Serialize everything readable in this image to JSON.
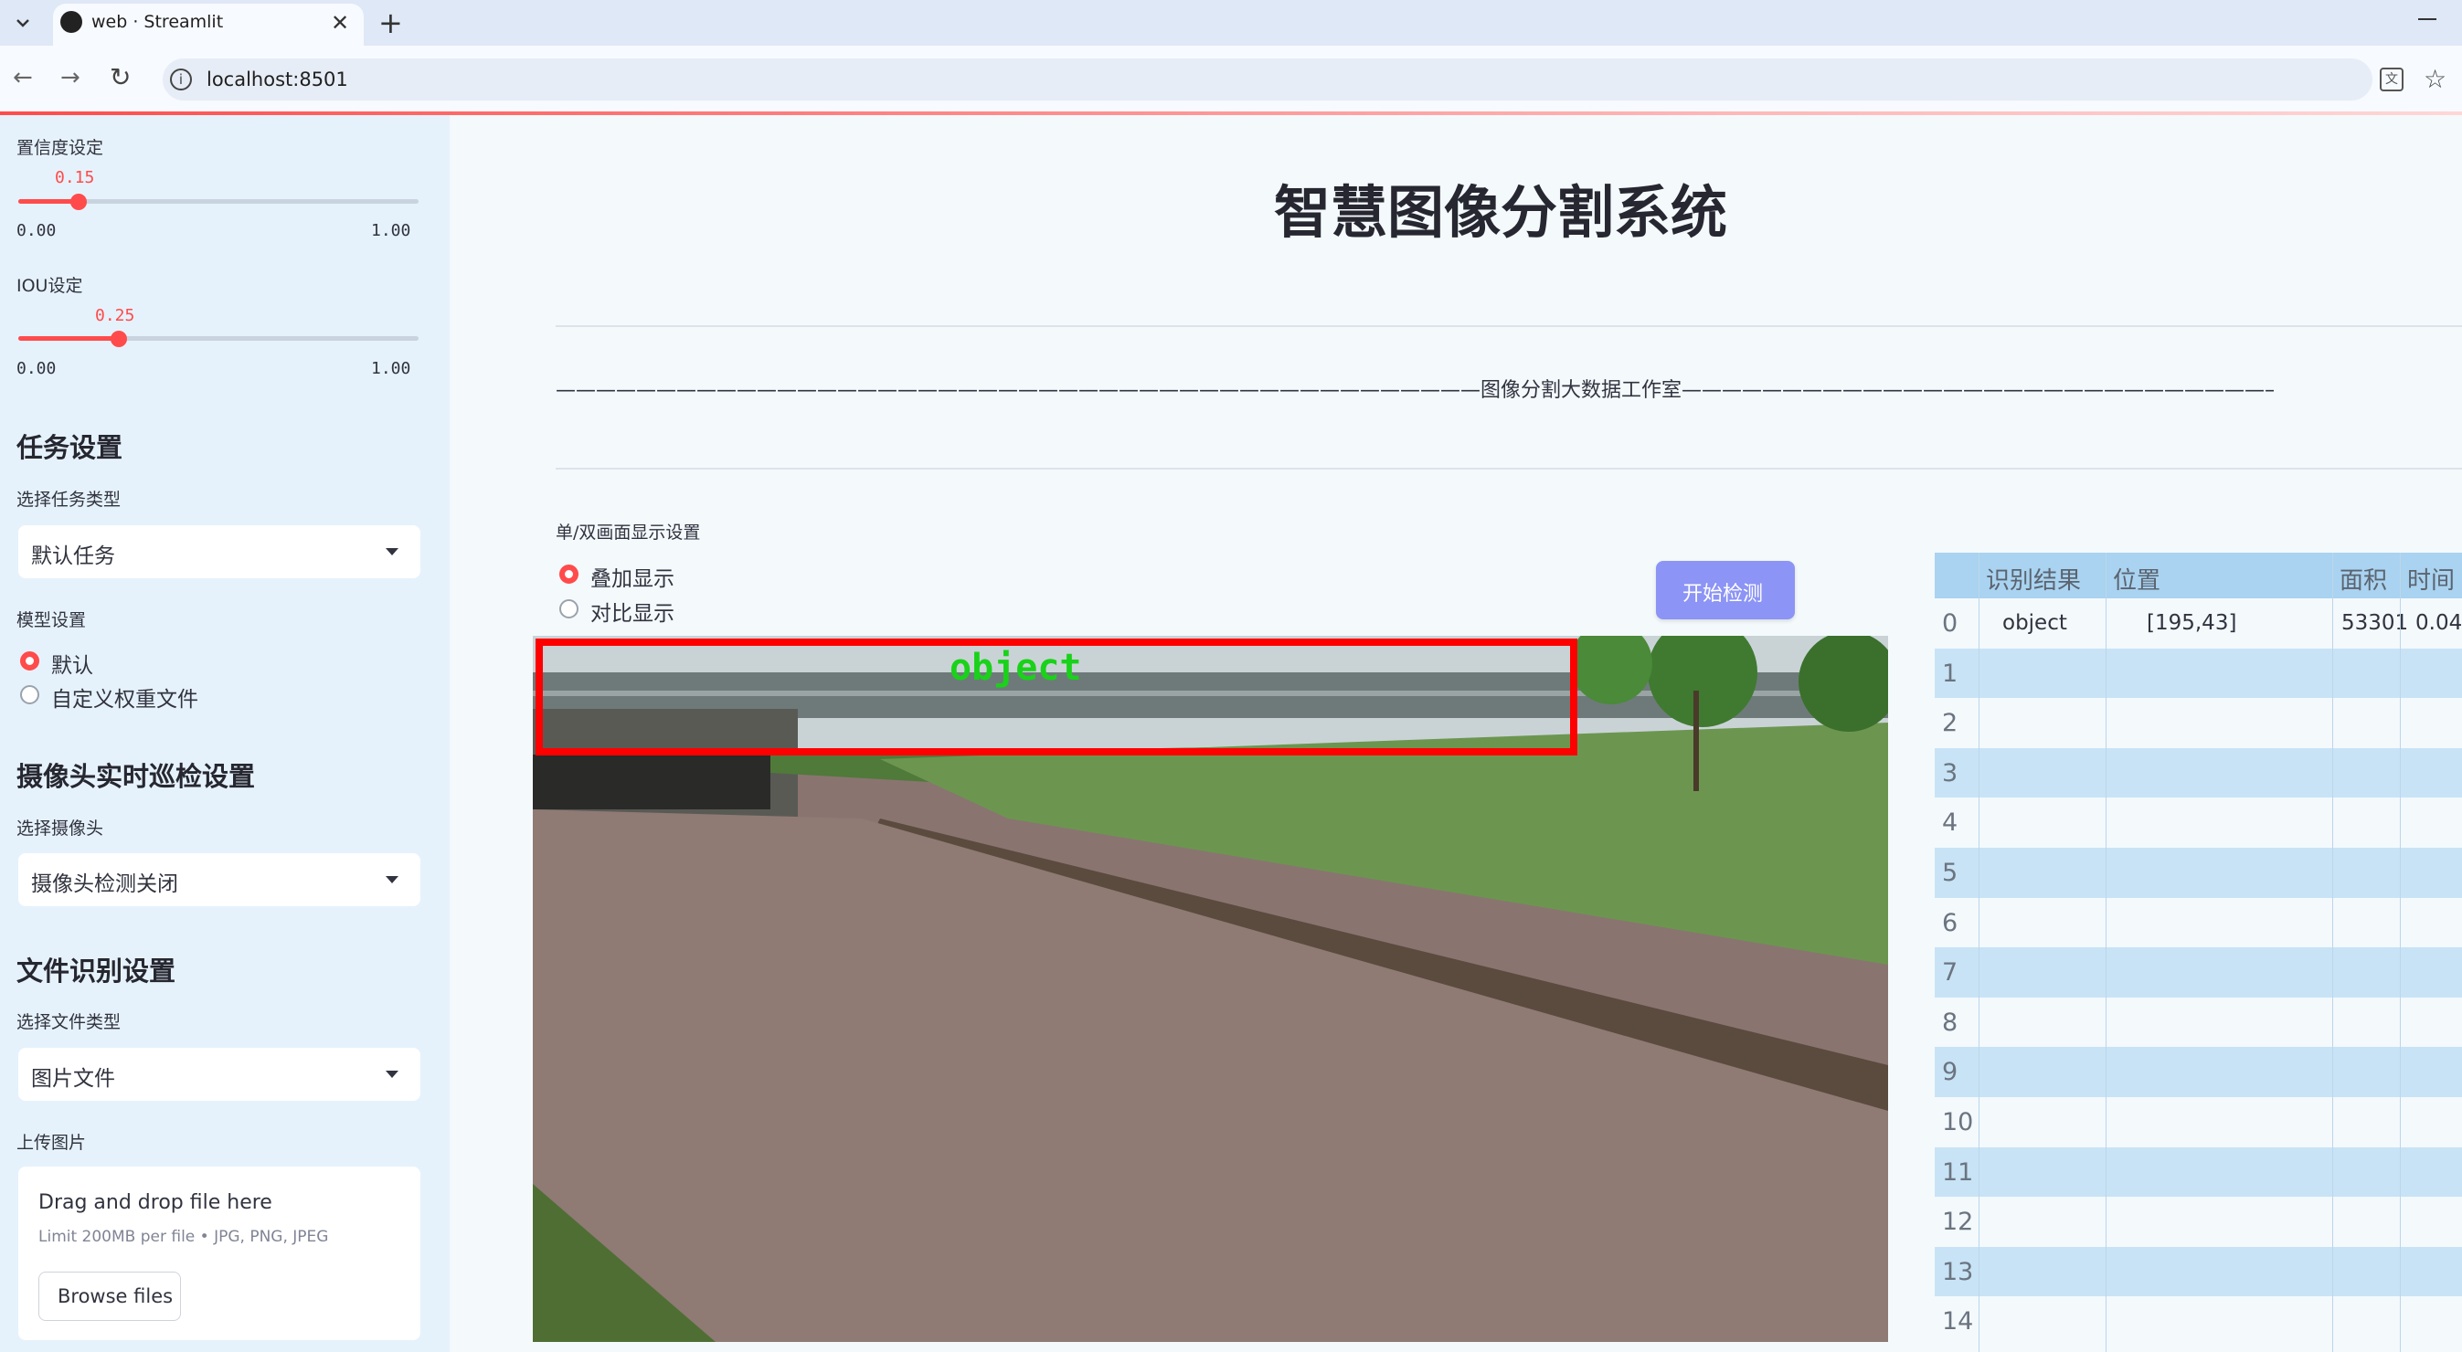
{
  "browser": {
    "tab_title": "web · Streamlit",
    "url": "localhost:8501"
  },
  "sidebar": {
    "confidence": {
      "label": "置信度设定",
      "value": "0.15",
      "min": "0.00",
      "max": "1.00",
      "fraction": 0.15
    },
    "iou": {
      "label": "IOU设定",
      "value": "0.25",
      "min": "0.00",
      "max": "1.00",
      "fraction": 0.25
    },
    "task_section": "任务设置",
    "task_type_label": "选择任务类型",
    "task_type_value": "默认任务",
    "model_label": "模型设置",
    "model_options": [
      "默认",
      "自定义权重文件"
    ],
    "camera_section": "摄像头实时巡检设置",
    "camera_label": "选择摄像头",
    "camera_value": "摄像头检测关闭",
    "file_section": "文件识别设置",
    "file_type_label": "选择文件类型",
    "file_type_value": "图片文件",
    "upload_label": "上传图片",
    "upload_drag": "Drag and drop file here",
    "upload_limit": "Limit 200MB per file • JPG, PNG, JPEG",
    "browse_label": "Browse files"
  },
  "main": {
    "title": "智慧图像分割系统",
    "divider_text": "——————————————————————————————————————————————图像分割大数据工作室——————————————————————————————————————————————————",
    "display_label": "单/双画面显示设置",
    "display_options": [
      "叠加显示",
      "对比显示"
    ],
    "start_button": "开始检测",
    "detection_label": "object"
  },
  "table": {
    "headers": [
      "识别结果",
      "位置",
      "面积",
      "时间"
    ],
    "rows": [
      {
        "idx": "0",
        "result": "object",
        "position": "[195,43]",
        "area": "53301",
        "time": "0.04"
      },
      {
        "idx": "1"
      },
      {
        "idx": "2"
      },
      {
        "idx": "3"
      },
      {
        "idx": "4"
      },
      {
        "idx": "5"
      },
      {
        "idx": "6"
      },
      {
        "idx": "7"
      },
      {
        "idx": "8"
      },
      {
        "idx": "9"
      },
      {
        "idx": "10"
      },
      {
        "idx": "11"
      },
      {
        "idx": "12"
      },
      {
        "idx": "13"
      },
      {
        "idx": "14"
      }
    ]
  },
  "colors": {
    "accent": "#ff4b4b",
    "button": "#8c94f5",
    "table_header": "#a9d3f0",
    "table_stripe": "#c8e3f6"
  }
}
